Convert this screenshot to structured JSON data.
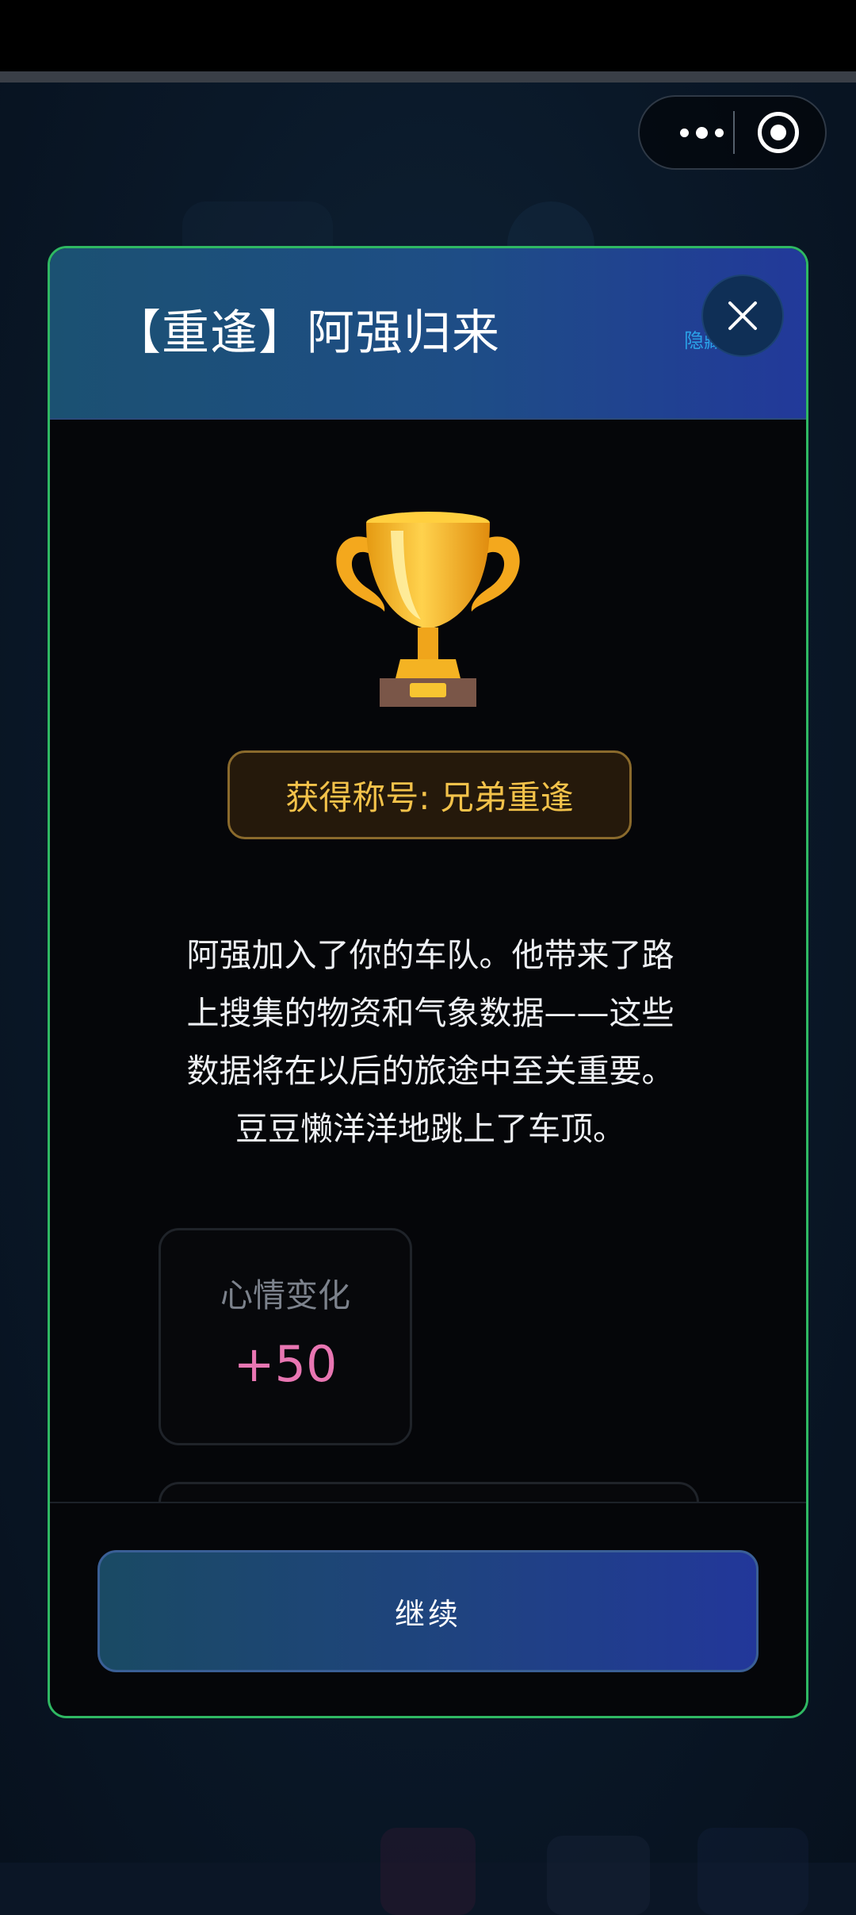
{
  "header": {
    "title": "【重逢】阿强归来",
    "hide_label": "隐藏机遇"
  },
  "capsule": {
    "more_icon": "more-dots-icon",
    "close_icon": "target-circle-icon"
  },
  "reward": {
    "icon": "trophy-icon",
    "title_badge": "获得称号: 兄弟重逢"
  },
  "story": {
    "lines": [
      "阿强加入了你的车队。他带来了路",
      "上搜集的物资和气象数据——这些",
      "数据将在以后的旅途中至关重要。",
      "豆豆懒洋洋地跳上了车顶。"
    ]
  },
  "stats": [
    {
      "label": "心情变化",
      "value": "+50"
    }
  ],
  "footer": {
    "continue_label": "继续"
  },
  "colors": {
    "modal_border": "#2fb863",
    "badge_text": "#f3c24a",
    "stat_value": "#e876b2",
    "header_gradient_start": "#1b5172",
    "header_gradient_end": "#22399a"
  }
}
